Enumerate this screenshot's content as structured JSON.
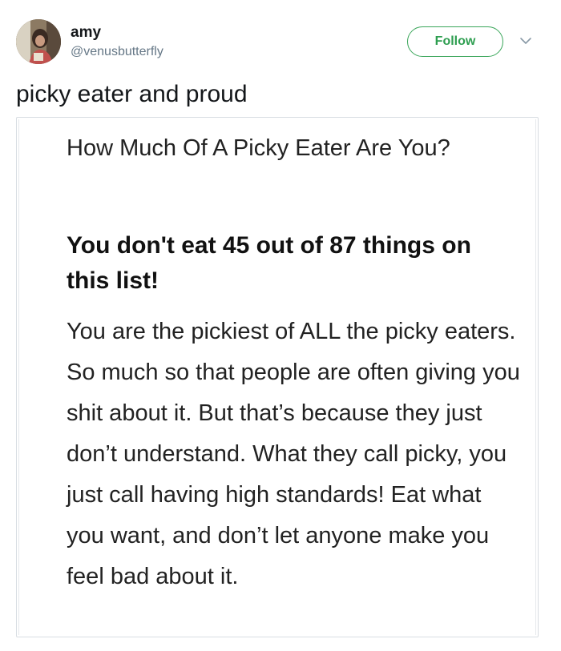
{
  "user": {
    "display_name": "amy",
    "handle": "@venusbutterfly"
  },
  "actions": {
    "follow_label": "Follow"
  },
  "tweet": {
    "text": "picky eater and proud"
  },
  "quiz_card": {
    "title": "How Much Of A Picky Eater Are You?",
    "result_heading": "You don't eat 45 out of 87 things on this list!",
    "result_body": "You are the pickiest of ALL the picky eaters. So much so that people are often giving you shit about it. But that’s because they just don’t understand. What they call picky, you just call having high standards! Eat what you want, and don’t let anyone make you feel bad about it."
  },
  "icons": {
    "menu": "chevron-down-icon",
    "avatar": "avatar"
  },
  "colors": {
    "follow_accent": "#3aa65a",
    "handle_gray": "#657786",
    "card_border": "#d8dde2"
  }
}
